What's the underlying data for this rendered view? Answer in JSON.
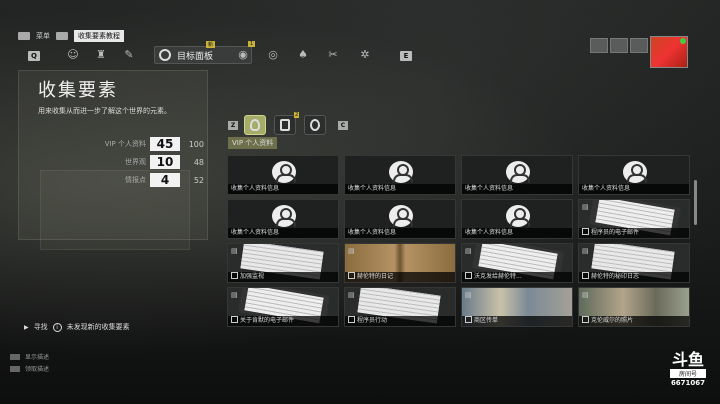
{
  "topbar": {
    "menu_label": "菜单",
    "breadcrumb": "收集要素教程"
  },
  "nav": {
    "key_left": "Q",
    "key_right": "E",
    "active_tab_label": "目标面板",
    "new_badge": "新",
    "notify_badge": "1",
    "icons": [
      "user-icon",
      "group-icon",
      "wrench-icon",
      "target-icon",
      "gps-icon",
      "shirt-icon",
      "tools-icon",
      "gear-icon"
    ]
  },
  "page": {
    "title": "收集要素",
    "description": "用来收集从而进一步了解这个世界的元素。"
  },
  "stats": [
    {
      "label": "VIP 个人资料",
      "value": "45",
      "total": "100"
    },
    {
      "label": "世界观",
      "value": "10",
      "total": "48"
    },
    {
      "label": "情报点",
      "value": "4",
      "total": "52"
    }
  ],
  "filters": {
    "key_left": "Z",
    "key_right": "C",
    "count_badge": "2",
    "active_label": "VIP 个人资料"
  },
  "cards": [
    {
      "caption": "收集个人资料信息",
      "kind": "profile"
    },
    {
      "caption": "收集个人资料信息",
      "kind": "profile"
    },
    {
      "caption": "收集个人资料信息",
      "kind": "profile"
    },
    {
      "caption": "收集个人资料信息",
      "kind": "profile"
    },
    {
      "caption": "收集个人资料信息",
      "kind": "profile"
    },
    {
      "caption": "收集个人资料信息",
      "kind": "profile"
    },
    {
      "caption": "收集个人资料信息",
      "kind": "profile"
    },
    {
      "caption": "程序员的电子邮件",
      "kind": "tablet"
    },
    {
      "caption": "加强监视",
      "kind": "paper"
    },
    {
      "caption": "赫伦特的日记",
      "kind": "book"
    },
    {
      "caption": "沃克发给赫伦特...",
      "kind": "tablet"
    },
    {
      "caption": "赫伦特的秘印日志",
      "kind": "paper"
    },
    {
      "caption": "关于肯默的电子邮件",
      "kind": "tablet"
    },
    {
      "caption": "程序员行动",
      "kind": "paper"
    },
    {
      "caption": "商区传单",
      "kind": "photo"
    },
    {
      "caption": "克伦威尔的照片",
      "kind": "photo2"
    }
  ],
  "find": {
    "label": "寻找",
    "action": "未发现新的收集要素"
  },
  "legend": [
    "显示描述",
    "领取描述"
  ],
  "watermark": {
    "mark": "斗鱼",
    "sub": "房间号",
    "room": "6671067"
  },
  "colors": {
    "accent": "#a6ac6a",
    "badge": "#c9b23a"
  }
}
